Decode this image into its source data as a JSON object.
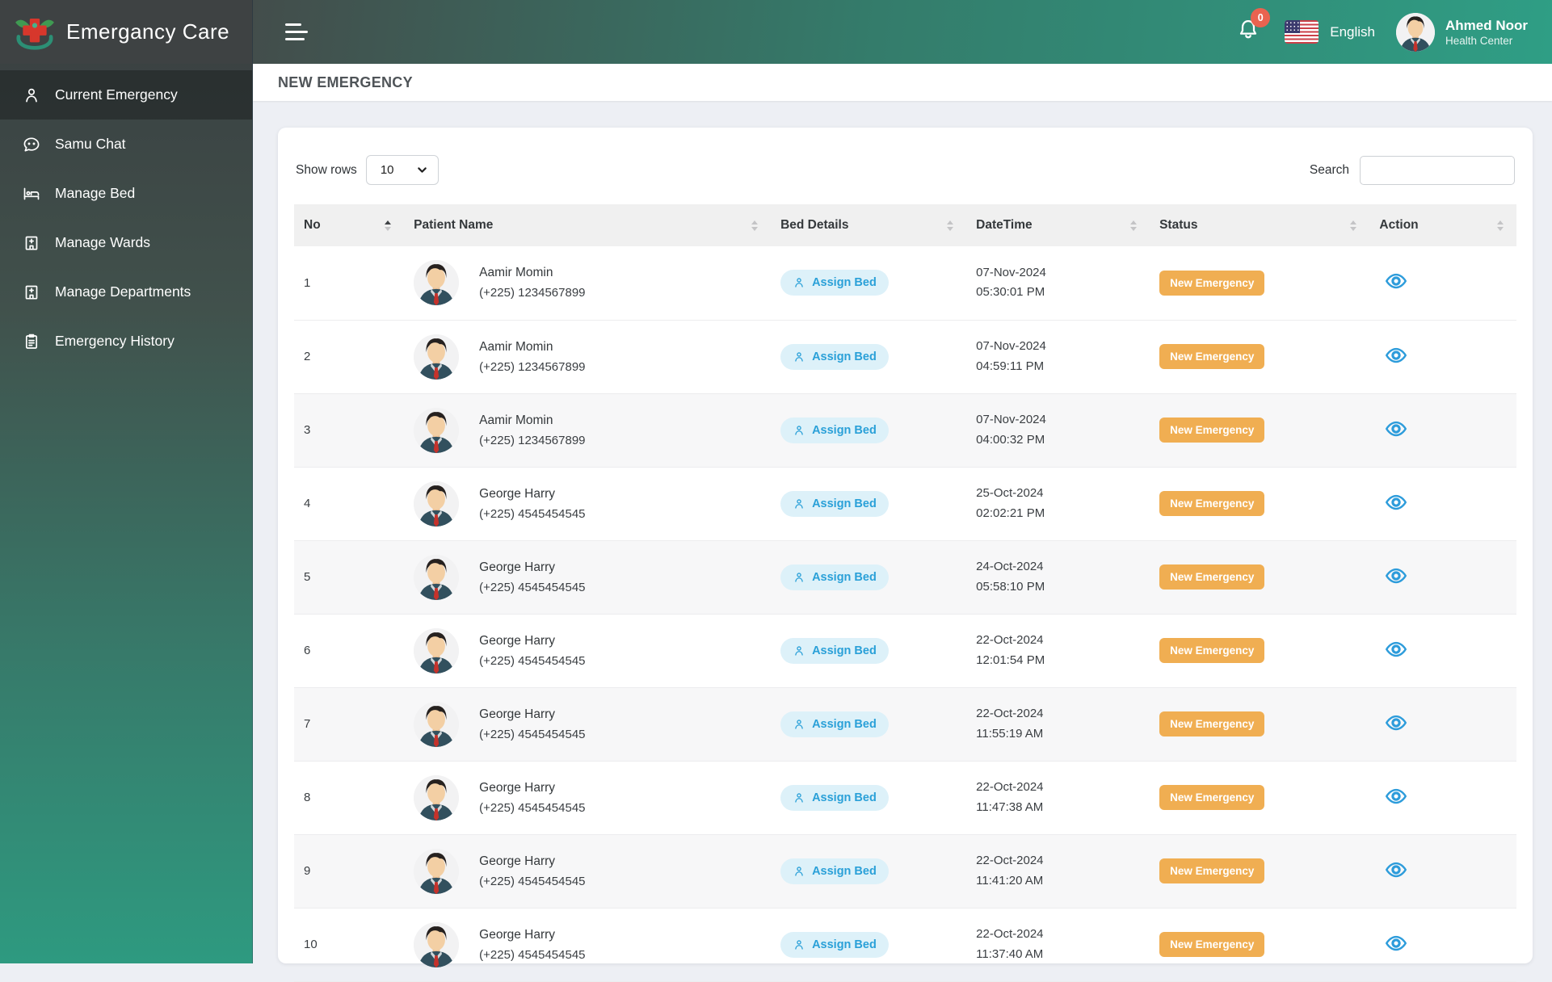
{
  "brand": {
    "name": "Emergancy Care"
  },
  "topbar": {
    "notification_count": "0",
    "language": "English",
    "user_name": "Ahmed Noor",
    "user_subtitle": "Health Center"
  },
  "sidebar": {
    "items": [
      {
        "label": "Current Emergency",
        "icon": "person",
        "active": true
      },
      {
        "label": "Samu Chat",
        "icon": "chat",
        "active": false
      },
      {
        "label": "Manage Bed",
        "icon": "bed",
        "active": false
      },
      {
        "label": "Manage Wards",
        "icon": "hospital",
        "active": false
      },
      {
        "label": "Manage Departments",
        "icon": "hospital",
        "active": false
      },
      {
        "label": "Emergency History",
        "icon": "clipboard",
        "active": false
      }
    ]
  },
  "page": {
    "title": "NEW EMERGENCY"
  },
  "toolbar": {
    "show_rows_label": "Show rows",
    "show_rows_value": "10",
    "search_label": "Search",
    "search_value": ""
  },
  "table": {
    "columns": [
      {
        "label": "No",
        "sorted": "asc"
      },
      {
        "label": "Patient Name",
        "sorted": null
      },
      {
        "label": "Bed Details",
        "sorted": null
      },
      {
        "label": "DateTime",
        "sorted": null
      },
      {
        "label": "Status",
        "sorted": null
      },
      {
        "label": "Action",
        "sorted": null
      }
    ],
    "assign_bed_label": "Assign Bed",
    "rows": [
      {
        "no": "1",
        "name": "Aamir Momin",
        "phone": "(+225) 1234567899",
        "date": "07-Nov-2024",
        "time": "05:30:01 PM",
        "status": "New Emergency"
      },
      {
        "no": "2",
        "name": "Aamir Momin",
        "phone": "(+225) 1234567899",
        "date": "07-Nov-2024",
        "time": "04:59:11 PM",
        "status": "New Emergency"
      },
      {
        "no": "3",
        "name": "Aamir Momin",
        "phone": "(+225) 1234567899",
        "date": "07-Nov-2024",
        "time": "04:00:32 PM",
        "status": "New Emergency"
      },
      {
        "no": "4",
        "name": "George Harry",
        "phone": "(+225) 4545454545",
        "date": "25-Oct-2024",
        "time": "02:02:21 PM",
        "status": "New Emergency"
      },
      {
        "no": "5",
        "name": "George Harry",
        "phone": "(+225) 4545454545",
        "date": "24-Oct-2024",
        "time": "05:58:10 PM",
        "status": "New Emergency"
      },
      {
        "no": "6",
        "name": "George Harry",
        "phone": "(+225) 4545454545",
        "date": "22-Oct-2024",
        "time": "12:01:54 PM",
        "status": "New Emergency"
      },
      {
        "no": "7",
        "name": "George Harry",
        "phone": "(+225) 4545454545",
        "date": "22-Oct-2024",
        "time": "11:55:19 AM",
        "status": "New Emergency"
      },
      {
        "no": "8",
        "name": "George Harry",
        "phone": "(+225) 4545454545",
        "date": "22-Oct-2024",
        "time": "11:47:38 AM",
        "status": "New Emergency"
      },
      {
        "no": "9",
        "name": "George Harry",
        "phone": "(+225) 4545454545",
        "date": "22-Oct-2024",
        "time": "11:41:20 AM",
        "status": "New Emergency"
      },
      {
        "no": "10",
        "name": "George Harry",
        "phone": "(+225) 4545454545",
        "date": "22-Oct-2024",
        "time": "11:37:40 AM",
        "status": "New Emergency"
      }
    ]
  },
  "colors": {
    "topbar_teal": "#2f9e85",
    "sidebar_dark": "#393e40",
    "status_badge": "#f0ae52",
    "assign_pill_bg": "#ddf1f9",
    "assign_pill_text": "#2aa0d8",
    "action_icon": "#2d9cdb",
    "notification_badge": "#e96350"
  }
}
